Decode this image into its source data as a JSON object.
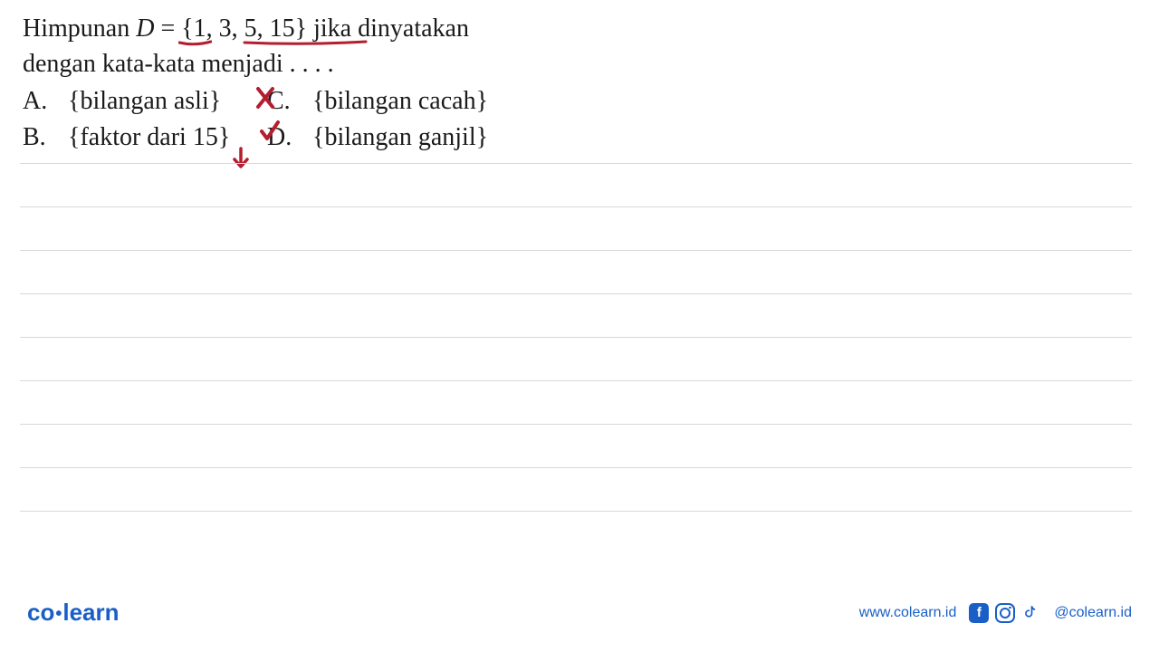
{
  "question": {
    "line1_part1": "Himpunan ",
    "line1_var": "D",
    "line1_part2": " = {1, 3, 5, 15} jika dinyatakan",
    "line2": "dengan kata-kata menjadi . . . .",
    "options": {
      "a": {
        "label": "A.",
        "text": "{bilangan asli}"
      },
      "b": {
        "label": "B.",
        "text": "{faktor dari 15}"
      },
      "c": {
        "label": "C.",
        "text": "{bilangan cacah}"
      },
      "d": {
        "label": "D.",
        "text": "{bilangan ganjil}"
      }
    }
  },
  "annotations": {
    "stroke_color": "#b41e2e"
  },
  "footer": {
    "logo_co": "co",
    "logo_learn": "learn",
    "website": "www.colearn.id",
    "handle": "@colearn.id"
  }
}
